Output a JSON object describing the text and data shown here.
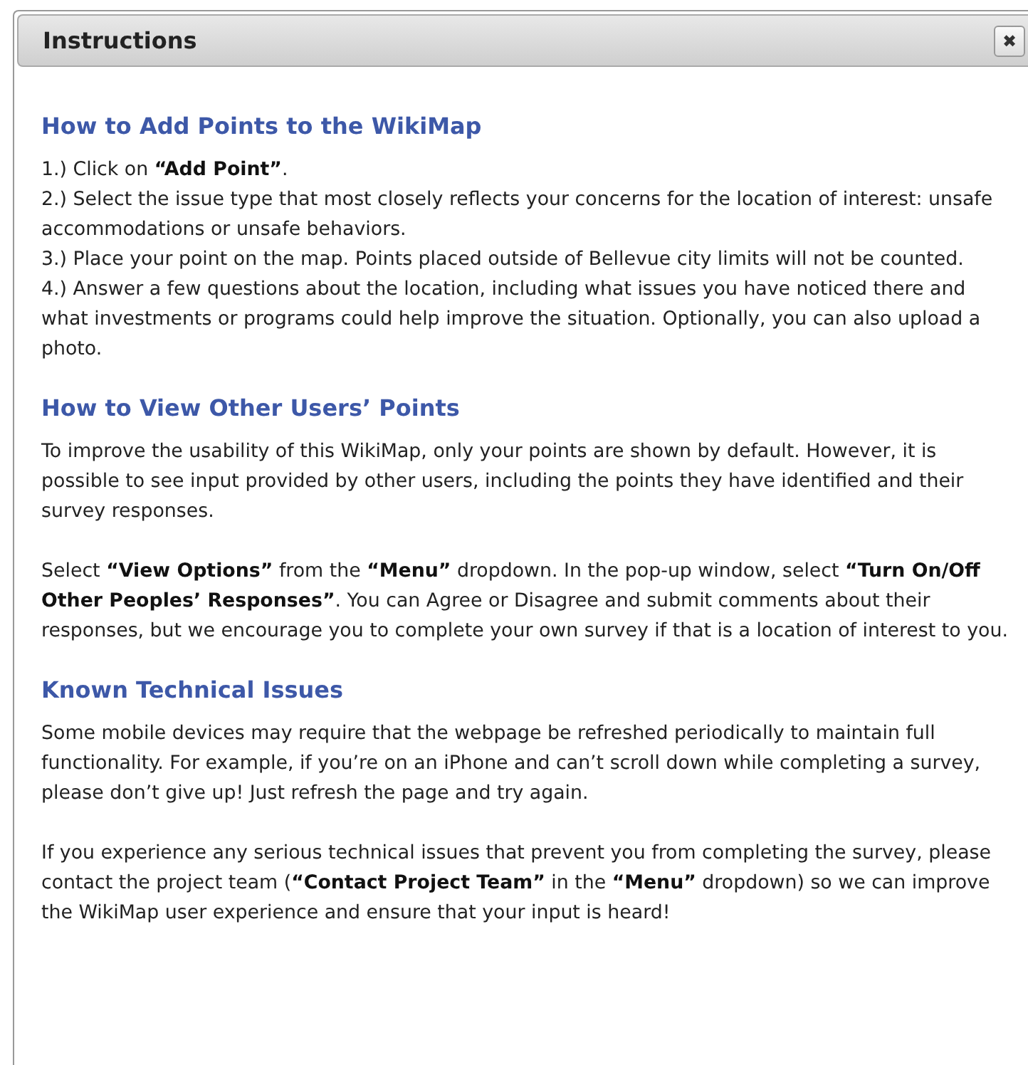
{
  "dialog": {
    "title": "Instructions",
    "close_label": "✖"
  },
  "sections": [
    {
      "heading": "How to Add Points to the WikiMap",
      "blocks": [
        [
          "1.) Click on **“Add Point”**.",
          "2.) Select the issue type that most closely reflects your concerns for the location of interest: unsafe accommodations or unsafe behaviors.",
          "3.) Place your point on the map. Points placed outside of Bellevue city limits will not be counted.",
          "4.) Answer a few questions about the location, including what issues you have noticed there and what investments or programs could help improve the situation. Optionally, you can also upload a photo."
        ]
      ]
    },
    {
      "heading": "How to View Other Users’ Points",
      "blocks": [
        [
          "To improve the usability of this WikiMap, only your points are shown by default. However, it is possible to see input provided by other users, including the points they have identified and their survey responses."
        ],
        [
          "Select **“View Options”** from the **“Menu”** dropdown. In the pop-up window, select **“Turn On/Off Other Peoples’ Responses”**. You can Agree or Disagree and submit comments about their responses, but we encourage you to complete your own survey if that is a location of interest to you."
        ]
      ]
    },
    {
      "heading": "Known Technical Issues",
      "blocks": [
        [
          "Some mobile devices may require that the webpage be refreshed periodically to maintain full functionality. For example, if you’re on an iPhone and can’t scroll down while completing a survey, please don’t give up! Just refresh the page and try again."
        ],
        [
          "If you experience any serious technical issues that prevent you from completing the survey, please contact the project team (**“Contact Project Team”** in the **“Menu”** dropdown) so we can improve the WikiMap user experience and ensure that your input is heard!"
        ]
      ]
    }
  ]
}
